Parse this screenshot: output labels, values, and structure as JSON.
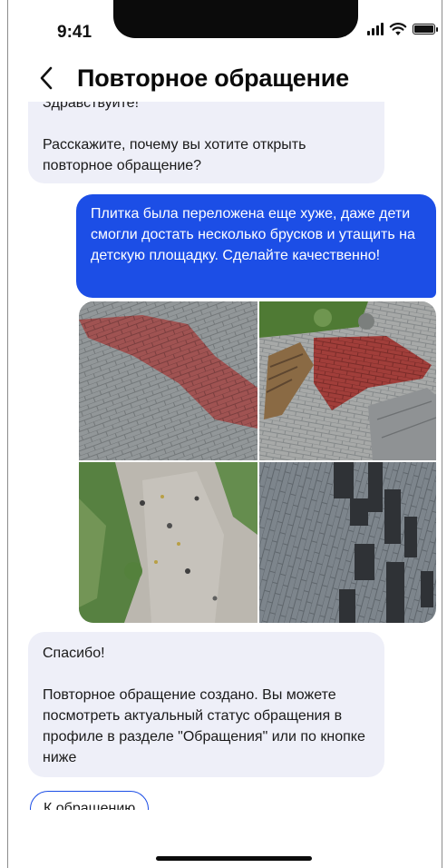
{
  "status_bar": {
    "time": "9:41",
    "icons": [
      "signal-icon",
      "wifi-icon",
      "battery-icon"
    ]
  },
  "header": {
    "back_icon": "chevron-left-icon",
    "title": "Повторное обращение"
  },
  "messages": [
    {
      "from": "support",
      "greeting": "Здравствуйте!",
      "text": "Расскажите, почему вы хотите открыть повторное обращение?"
    },
    {
      "from": "user",
      "text": "Плитка была переложена еще хуже, даже дети смогли достать несколько брусков и утащить на детскую площадку. Сделайте качественно!"
    },
    {
      "from": "user",
      "type": "photos",
      "count": 4
    },
    {
      "from": "support",
      "title": "Спасибо!",
      "text": "Повторное обращение создано. Вы можете посмотреть актуальный статус обращения в профиле в разделе \"Обращения\" или по кнопке ниже"
    }
  ],
  "action_button": {
    "label": "К обращению"
  },
  "colors": {
    "accent": "#1c4ee6",
    "incoming_bubble": "#eeeff8",
    "text": "#1a1a1a"
  }
}
